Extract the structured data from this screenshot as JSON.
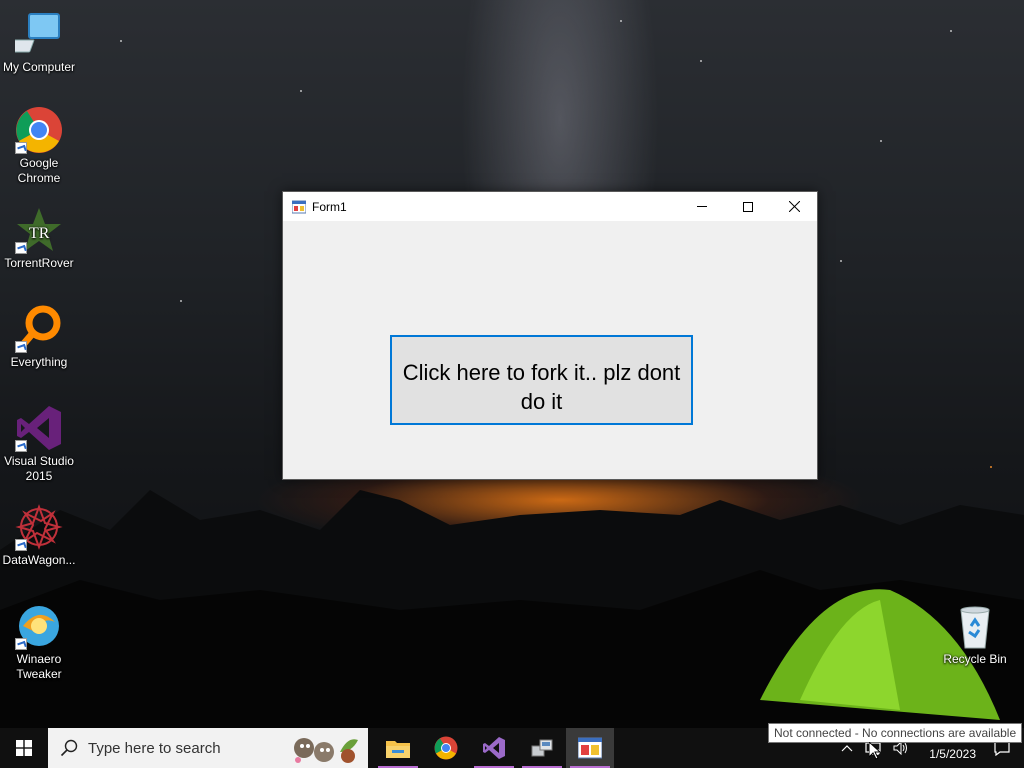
{
  "desktop": {
    "icons": [
      {
        "label": "My Computer",
        "icon": "computer-icon"
      },
      {
        "label": "Google Chrome",
        "icon": "chrome-icon"
      },
      {
        "label": "TorrentRover",
        "icon": "torrentrover-icon"
      },
      {
        "label": "Everything",
        "icon": "everything-search-icon"
      },
      {
        "label": "Visual Studio 2015",
        "icon": "visual-studio-icon"
      },
      {
        "label": "DataWagon...",
        "icon": "datawagon-icon"
      },
      {
        "label": "Winaero Tweaker",
        "icon": "winaero-tweaker-icon"
      },
      {
        "label": "Recycle Bin",
        "icon": "recycle-bin-icon"
      }
    ]
  },
  "window": {
    "title": "Form1",
    "button_text": "Click here to fork it.. plz dont do it",
    "accent": "#0078d7"
  },
  "taskbar": {
    "search_placeholder": "Type here to search",
    "apps": [
      "file-explorer-icon",
      "chrome-icon",
      "visual-studio-icon",
      "network-tool-icon",
      "form-app-icon"
    ],
    "date": "1/5/2023",
    "network_tooltip": "Not connected - No connections are available"
  }
}
